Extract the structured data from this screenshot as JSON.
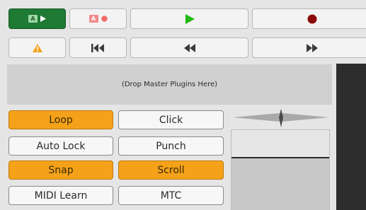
{
  "transport_top": {
    "auto_play_badge": "A",
    "auto_return_badge": "A"
  },
  "plugins": {
    "drop_text": "(Drop Master Plugins Here)"
  },
  "toggles": {
    "loop": "Loop",
    "click": "Click",
    "auto_lock": "Auto Lock",
    "punch": "Punch",
    "snap": "Snap",
    "scroll": "Scroll",
    "midi_learn": "MIDI Learn",
    "mtc": "MTC"
  },
  "states": {
    "loop_on": true,
    "click_on": false,
    "auto_lock_on": false,
    "punch_on": false,
    "snap_on": true,
    "scroll_on": true,
    "midi_learn_on": false,
    "mtc_on": false
  },
  "colors": {
    "active_green": "#1f7a33",
    "play_green": "#22b814",
    "record_red": "#8c0a0a",
    "warning_orange": "#f5a21a",
    "toggle_on": "#f5a21a",
    "meter_dark": "#2d2d2d"
  },
  "icons": {
    "play": "play-icon",
    "record": "record-icon",
    "warning": "warning-icon",
    "goto_start": "goto-start-icon",
    "rewind": "rewind-icon",
    "fast_forward": "fast-forward-icon"
  }
}
